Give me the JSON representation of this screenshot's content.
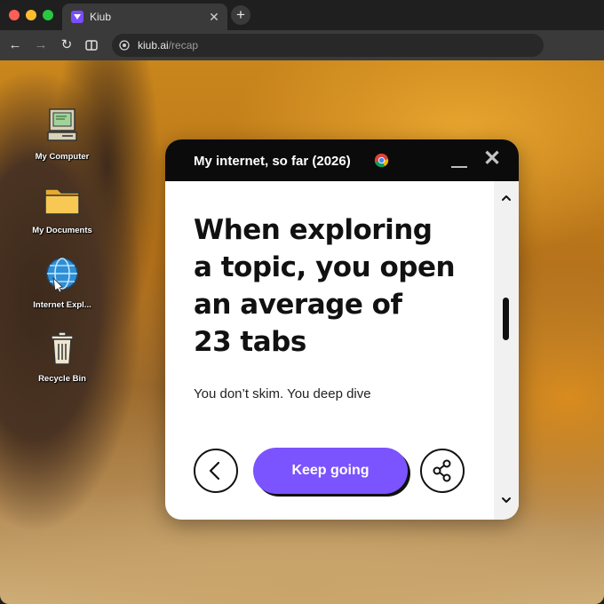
{
  "browser": {
    "tab": {
      "title": "Kiub",
      "favicon": "kiub-logo-icon"
    },
    "new_tab_label": "+",
    "tab_close_label": "✕",
    "nav": {
      "back": "←",
      "forward": "→",
      "reload": "↻"
    },
    "address": {
      "domain": "kiub.ai",
      "path": "/recap"
    }
  },
  "desktop": {
    "icons": [
      {
        "label": "My Computer",
        "icon": "computer-icon"
      },
      {
        "label": "My Documents",
        "icon": "folder-icon"
      },
      {
        "label": "Internet Expl...",
        "icon": "internet-explorer-icon"
      },
      {
        "label": "Recycle Bin",
        "icon": "recycle-bin-icon"
      }
    ]
  },
  "popup": {
    "title": "My internet, so far (2026)",
    "close_label": "✕",
    "headline": [
      "When exploring",
      "a topic, you open",
      "an average of",
      "23 tabs"
    ],
    "subline": "You don’t skim. You deep dive",
    "primary_button": "Keep going",
    "accent_color": "#7b53ff"
  }
}
